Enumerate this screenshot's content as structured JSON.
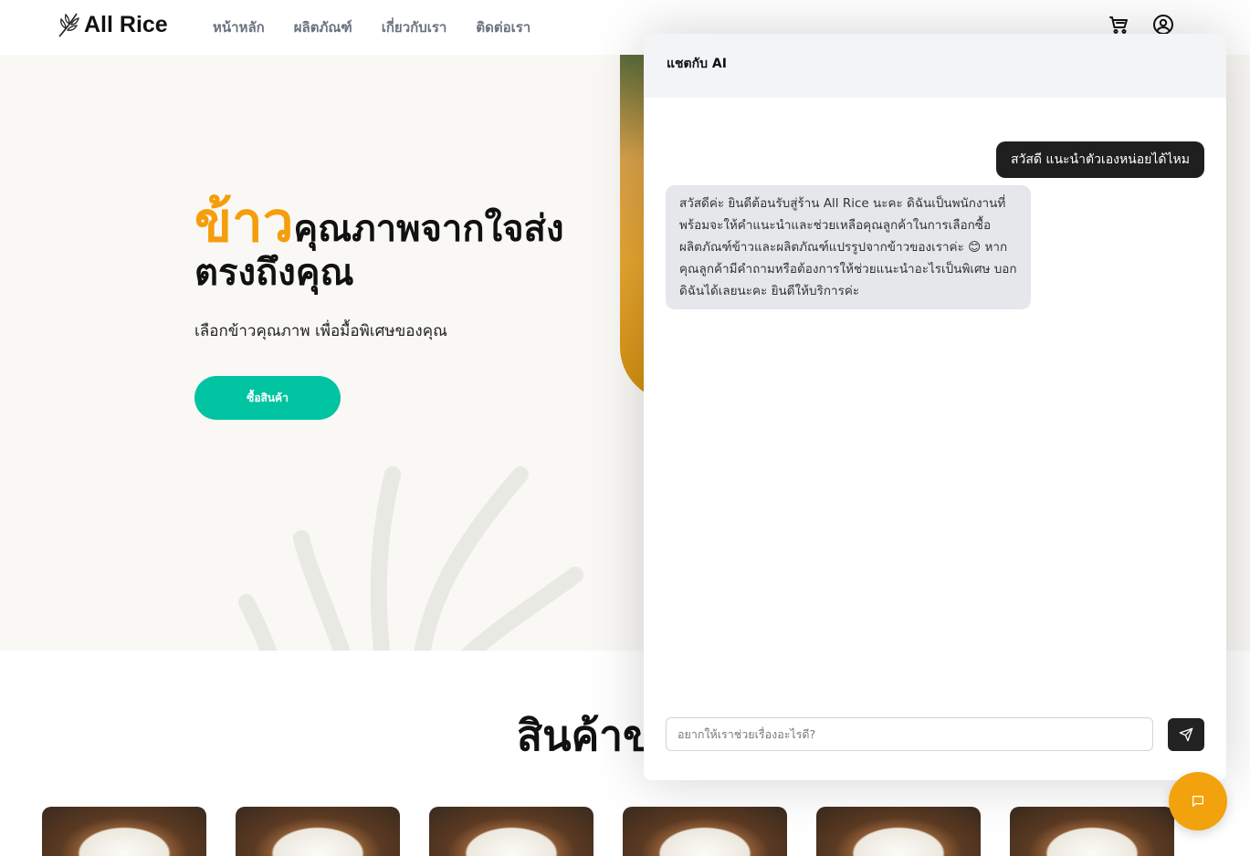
{
  "brand": {
    "name": "All Rice"
  },
  "nav": {
    "items": [
      {
        "label": "หน้าหลัก"
      },
      {
        "label": "ผลิตภัณฑ์"
      },
      {
        "label": "เกี่ยวกับเรา"
      },
      {
        "label": "ติดต่อเรา"
      }
    ]
  },
  "header_icons": [
    "cart-icon",
    "user-circle-icon"
  ],
  "hero": {
    "title_accent": "ข้าว",
    "title_rest": "คุณภาพจากใจส่งตรงถึงคุณ",
    "subtitle": "เลือกข้าวคุณภาพ เพื่อมื้อพิเศษของคุณ",
    "cta_label": "ซื้อสินค้า"
  },
  "products_section": {
    "title": "สินค้าข"
  },
  "chat": {
    "title": "แชตกับ AI",
    "messages": [
      {
        "role": "user",
        "text": "สวัสดี แนะนำตัวเองหน่อยได้ไหม"
      },
      {
        "role": "ai",
        "text": "สวัสดีค่ะ ยินดีต้อนรับสู่ร้าน All Rice นะคะ ดิฉันเป็นพนักงานที่พร้อมจะให้คำแนะนำและช่วยเหลือคุณลูกค้าในการเลือกซื้อผลิตภัณฑ์ข้าวและผลิตภัณฑ์แปรรูปจากข้าวของเราค่ะ 😊 หากคุณลูกค้ามีคำถามหรือต้องการให้ช่วยแนะนำอะไรเป็นพิเศษ บอกดิฉันได้เลยนะคะ ยินดีให้บริการค่ะ"
      }
    ],
    "input_placeholder": "อยากให้เราช่วยเรื่องอะไรดี?",
    "input_value": ""
  },
  "colors": {
    "accent": "#f59e0b",
    "cta": "#00c4a1",
    "fab": "#f2a20c",
    "user_bubble": "#1f1f1f",
    "ai_bubble": "#e5e7eb"
  }
}
